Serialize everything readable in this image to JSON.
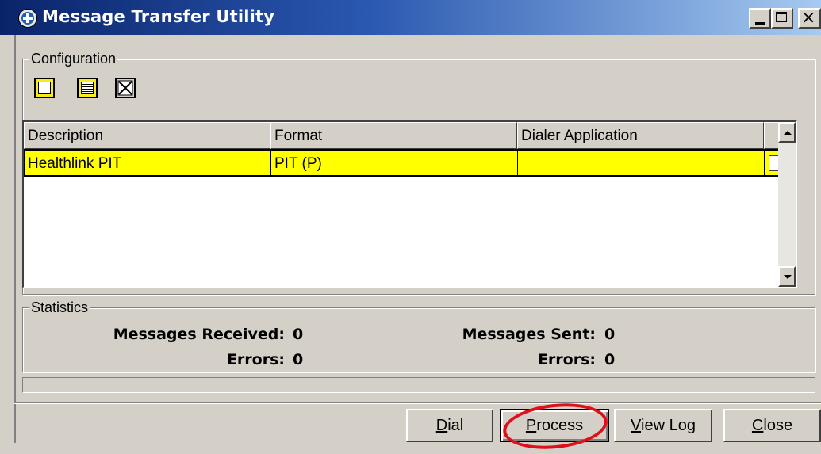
{
  "window": {
    "title": "Message Transfer Utility",
    "icon": "app-globe-icon",
    "controls": [
      "minimize-icon",
      "maximize-icon",
      "close-icon"
    ]
  },
  "configuration": {
    "label": "Configuration",
    "toolbar": [
      "new-config-icon",
      "edit-config-icon",
      "delete-config-icon"
    ],
    "grid": {
      "columns": [
        "Description",
        "Format",
        "Dialer Application",
        ""
      ],
      "rows": [
        {
          "description": "Healthlink PIT",
          "format": "PIT (P)",
          "dialer_application": "",
          "checked": false,
          "selected": true
        }
      ],
      "selected_row_color": "#ffff00"
    }
  },
  "statistics": {
    "label": "Statistics",
    "left": {
      "received_label": "Messages Received:",
      "received_value": "0",
      "errors_label": "Errors:",
      "errors_value": "0"
    },
    "right": {
      "sent_label": "Messages Sent:",
      "sent_value": "0",
      "errors_label": "Errors:",
      "errors_value": "0"
    }
  },
  "buttons": {
    "dial_pre": "",
    "dial_key": "D",
    "dial_post": "ial",
    "process_pre": "",
    "process_key": "P",
    "process_post": "rocess",
    "viewlog_pre": "",
    "viewlog_key": "V",
    "viewlog_post": "iew Log",
    "close_pre": "",
    "close_key": "C",
    "close_post": "lose"
  },
  "annotation": {
    "highlight": "process-button",
    "color": "#e0101a"
  }
}
